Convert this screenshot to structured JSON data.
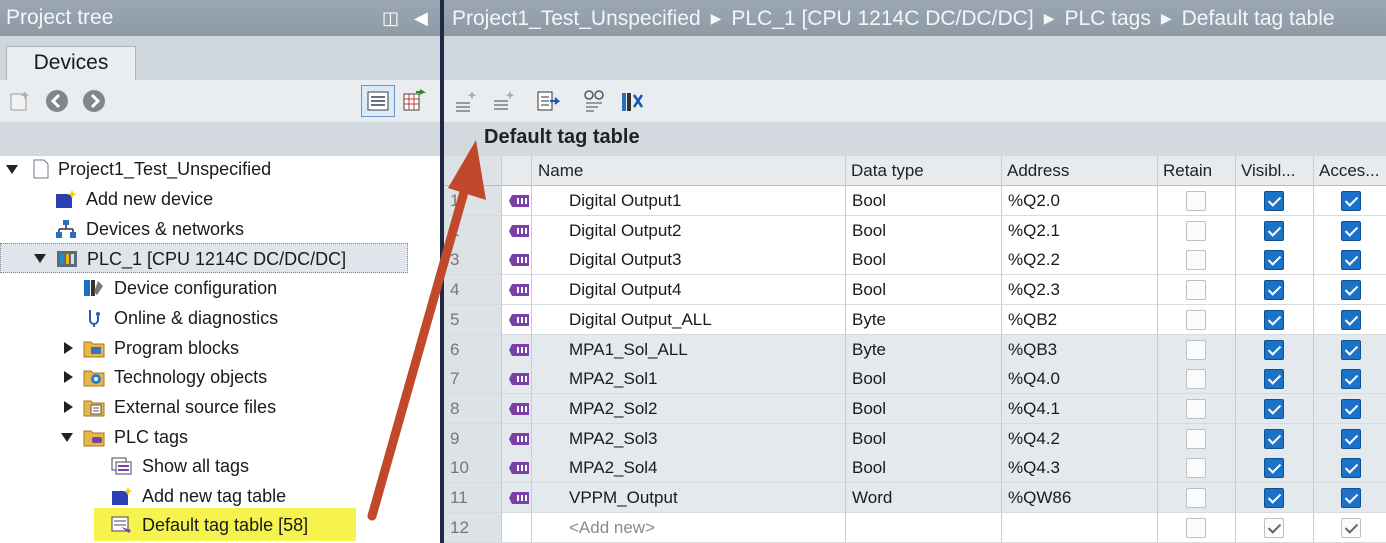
{
  "project_tree": {
    "title": "Project tree",
    "tab": "Devices",
    "items": [
      {
        "label": "Project1_Test_Unspecified"
      },
      {
        "label": "Add new device"
      },
      {
        "label": "Devices & networks"
      },
      {
        "label": "PLC_1 [CPU 1214C DC/DC/DC]"
      },
      {
        "label": "Device configuration"
      },
      {
        "label": "Online & diagnostics"
      },
      {
        "label": "Program blocks"
      },
      {
        "label": "Technology objects"
      },
      {
        "label": "External source files"
      },
      {
        "label": "PLC tags"
      },
      {
        "label": "Show all tags"
      },
      {
        "label": "Add new tag table"
      },
      {
        "label": "Default tag table [58]"
      }
    ]
  },
  "breadcrumb": [
    "Project1_Test_Unspecified",
    "PLC_1 [CPU 1214C DC/DC/DC]",
    "PLC tags",
    "Default tag table"
  ],
  "table": {
    "title": "Default tag table",
    "headers": {
      "name": "Name",
      "type": "Data type",
      "address": "Address",
      "retain": "Retain",
      "visible": "Visibl...",
      "accessible": "Acces..."
    },
    "rows": [
      {
        "num": "1",
        "name": "Digital Output1",
        "type": "Bool",
        "address": "%Q2.0"
      },
      {
        "num": "2",
        "name": "Digital Output2",
        "type": "Bool",
        "address": "%Q2.1"
      },
      {
        "num": "3",
        "name": "Digital Output3",
        "type": "Bool",
        "address": "%Q2.2"
      },
      {
        "num": "4",
        "name": "Digital Output4",
        "type": "Bool",
        "address": "%Q2.3"
      },
      {
        "num": "5",
        "name": "Digital Output_ALL",
        "type": "Byte",
        "address": "%QB2"
      },
      {
        "num": "6",
        "name": "MPA1_Sol_ALL",
        "type": "Byte",
        "address": "%QB3"
      },
      {
        "num": "7",
        "name": "MPA2_Sol1",
        "type": "Bool",
        "address": "%Q4.0"
      },
      {
        "num": "8",
        "name": "MPA2_Sol2",
        "type": "Bool",
        "address": "%Q4.1"
      },
      {
        "num": "9",
        "name": "MPA2_Sol3",
        "type": "Bool",
        "address": "%Q4.2"
      },
      {
        "num": "10",
        "name": "MPA2_Sol4",
        "type": "Bool",
        "address": "%Q4.3"
      },
      {
        "num": "11",
        "name": "VPPM_Output",
        "type": "Word",
        "address": "%QW86"
      }
    ],
    "add_new": {
      "num": "12",
      "name": "<Add new>"
    }
  },
  "colors": {
    "annotation_arrow": "#c0492c",
    "highlight": "#f6f24e",
    "checkbox_on": "#1a73c8"
  }
}
